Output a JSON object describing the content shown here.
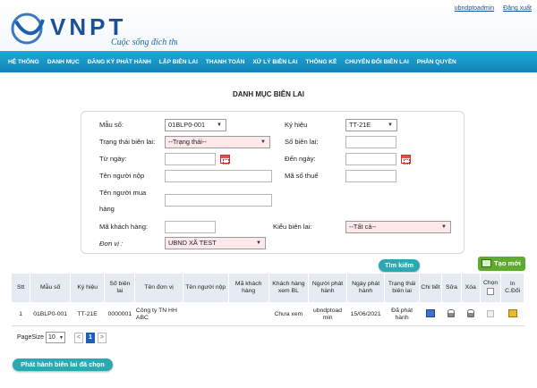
{
  "header": {
    "brand": "VNPT",
    "slogan": "Cuộc sống đích thực",
    "user_link": "ubndptoadmin",
    "logout_link": "Đăng xuất"
  },
  "menu": [
    "HỆ THỐNG",
    "DANH MỤC",
    "ĐĂNG KÝ PHÁT HÀNH",
    "LẬP BIÊN LAI",
    "THANH TOÁN",
    "XỬ LÝ BIÊN LAI",
    "THỐNG KÊ",
    "CHUYỂN ĐỔI BIÊN LAI",
    "PHẦN QUYỀN"
  ],
  "page_title": "DANH MỤC BIÊN LAI",
  "filter": {
    "mau_so_label": "Mẫu số:",
    "mau_so_value": "01BLP0-001",
    "ky_hieu_label": "Ký hiệu",
    "ky_hieu_value": "TT-21E",
    "trang_thai_label": "Trạng thái biên lai:",
    "trang_thai_value": "--Trạng thái--",
    "so_bien_lai_label": "Số biên lai:",
    "tu_ngay_label": "Từ ngày:",
    "den_ngay_label": "Đến ngày:",
    "ten_nguoi_nop_label": "Tên người nộp",
    "ma_so_thue_label": "Mã số thuế",
    "ten_nguoi_mua_label_1": "Tên người mua",
    "ten_nguoi_mua_label_2": "hàng",
    "ma_khach_hang_label": "Mã khách hàng:",
    "kieu_bien_lai_label": "Kiểu biên lai:",
    "kieu_bien_lai_value": "--Tất cả--",
    "don_vi_label": "Đơn vị :",
    "don_vi_value": "UBND XÃ TEST",
    "search_button": "Tìm kiếm"
  },
  "create_button": "Tạo mới",
  "table": {
    "headers": {
      "stt": "Stt",
      "mau_so": "Mẫu số",
      "ky_hieu": "Ký hiệu",
      "so_bien_lai": "Số biên lai",
      "ten_don_vi": "Tên đơn vị",
      "ten_nguoi_nop": "Tên người nộp",
      "ma_khach_hang": "Mã khách hàng",
      "kh_xem_bl": "Khách hàng xem BL",
      "nguoi_phat_hanh": "Người phát hành",
      "ngay_phat_hanh": "Ngày phát hành",
      "trang_thai": "Trạng thái biên lai",
      "chi_tiet": "Chi tiết",
      "sua": "Sửa",
      "xoa": "Xóa",
      "chon": "Chọn",
      "in_c_doi": "In C.Đổi"
    },
    "rows": [
      {
        "stt": "1",
        "mau_so": "01BLP0-001",
        "ky_hieu": "TT-21E",
        "so_bien_lai": "0000001",
        "ten_don_vi": "Công ty TN HH ABC",
        "ten_nguoi_nop": "",
        "ma_khach_hang": "",
        "kh_xem_bl": "Chưa xem",
        "nguoi_phat_hanh": "ubndptoad min",
        "ngay_phat_hanh": "15/06/2021",
        "trang_thai": "Đã phát hành"
      }
    ]
  },
  "pager": {
    "page_size_label": "PageSize",
    "page_size_value": "10",
    "prev": "<",
    "current_page": "1",
    "next": ">"
  },
  "publish_button": "Phát hành biên lai đã chọn",
  "colors": {
    "menu_bg": "#1482b6",
    "accent_teal": "#2aa9b3",
    "create_green": "#5fab2f",
    "brand_blue": "#1a4f9c"
  }
}
